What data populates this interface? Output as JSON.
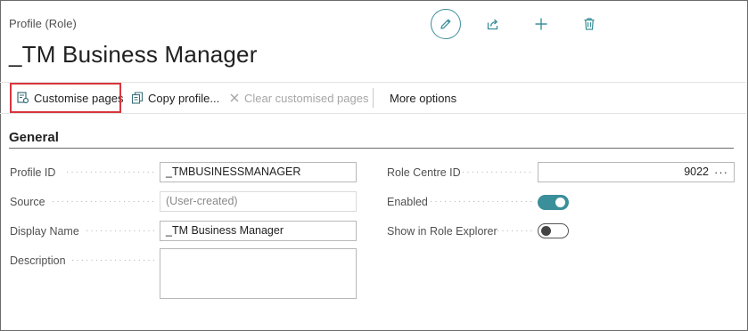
{
  "header": {
    "caption": "Profile (Role)",
    "title": "_TM Business Manager"
  },
  "icons": {
    "edit": "pencil-icon",
    "share": "share-icon",
    "new": "plus-icon",
    "delete": "trash-icon"
  },
  "actions": {
    "customise": "Customise pages",
    "copy": "Copy profile...",
    "clear": "Clear customised pages",
    "more": "More options"
  },
  "section": {
    "title": "General"
  },
  "fields": {
    "profile_id": {
      "label": "Profile ID",
      "value": "_TMBUSINESSMANAGER"
    },
    "source": {
      "label": "Source",
      "placeholder": "(User-created)"
    },
    "display_name": {
      "label": "Display Name",
      "value": "_TM Business Manager"
    },
    "description": {
      "label": "Description",
      "value": ""
    },
    "role_centre_id": {
      "label": "Role Centre ID",
      "value": "9022"
    },
    "enabled": {
      "label": "Enabled",
      "state": "on"
    },
    "show_in_explorer": {
      "label": "Show in Role Explorer",
      "state": "off"
    }
  },
  "colors": {
    "accent": "#3a8f9a",
    "highlight": "#d9363e"
  }
}
